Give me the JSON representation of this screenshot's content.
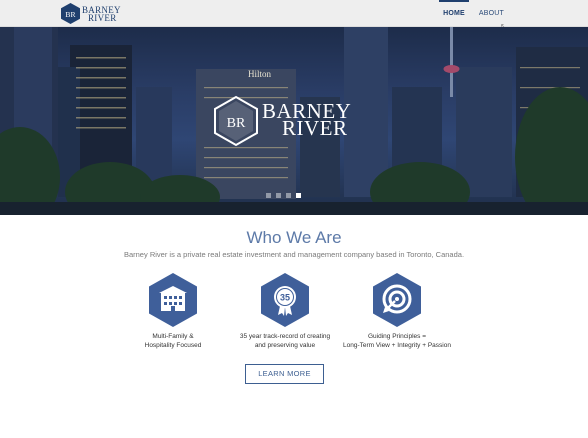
{
  "header": {
    "logo": {
      "line1": "BARNEY",
      "line2": "RIVER"
    },
    "nav": [
      {
        "label": "HOME",
        "active": true
      },
      {
        "label": "ABOUT",
        "active": false
      }
    ]
  },
  "hero": {
    "sign_text": "Hilton",
    "brand_line1": "BARNEY",
    "brand_line2": "RIVER",
    "slides": 4,
    "active_slide": 4
  },
  "who": {
    "title": "Who We Are",
    "subtitle": "Barney River is a private real estate investment and management company based in Toronto, Canada."
  },
  "features": [
    {
      "icon": "building-icon",
      "line1": "Multi-Family &",
      "line2": "Hospitality Focused"
    },
    {
      "icon": "badge-35-icon",
      "badge": "35",
      "line1": "35 year track-record of creating",
      "line2": "and preserving value"
    },
    {
      "icon": "target-icon",
      "line1": "Guiding Principles =",
      "line2": "Long-Term View + Integrity + Passion"
    }
  ],
  "cta": {
    "label": "LEARN MORE"
  },
  "colors": {
    "brand": "#1f3f6e",
    "accent": "#5d7aa8",
    "hex_fill": "#3f5f9a"
  }
}
